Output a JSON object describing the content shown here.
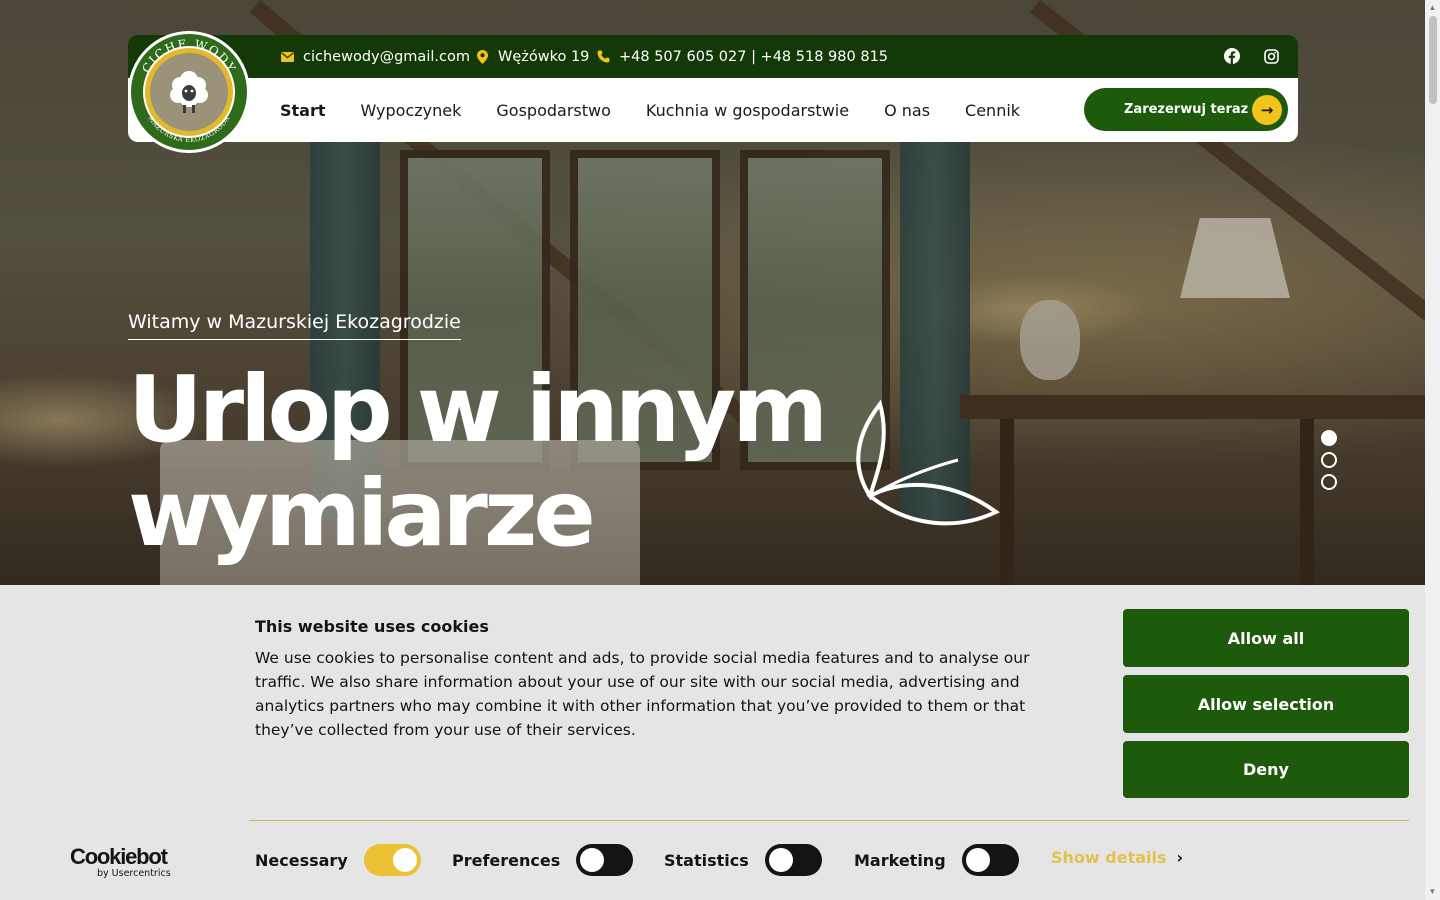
{
  "header": {
    "email": "cichewody@gmail.com",
    "address": "Wężówko 19",
    "phone": "+48 507 605 027 | +48 518 980 815",
    "logo_top_text": "CICHE WODY",
    "logo_bottom_text": "MAZURSKA EKOZAGRODA",
    "nav": [
      "Start",
      "Wypoczynek",
      "Gospodarstwo",
      "Kuchnia w gospodarstwie",
      "O nas",
      "Cennik"
    ],
    "book_button": "Zarezerwuj teraz",
    "book_arrow": "→"
  },
  "hero": {
    "kicker": "Witamy w Mazurskiej Ekozagrodzie",
    "title_line1": "Urlop w innym",
    "title_line2": "wymiarze",
    "slides_total": 3,
    "active_slide": 1
  },
  "cookie": {
    "title": "This website uses cookies",
    "body": "We use cookies to personalise content and ads, to provide social media features and to analyse our traffic. We also share information about your use of our site with our social media, advertising and analytics partners who may combine it with other information that you’ve provided to them or that they’ve collected from your use of their services.",
    "allow_all": "Allow all",
    "allow_selection": "Allow selection",
    "deny": "Deny",
    "brand_big": "Cookiebot",
    "brand_small": "by Usercentrics",
    "toggles": {
      "necessary": "Necessary",
      "preferences": "Preferences",
      "statistics": "Statistics",
      "marketing": "Marketing"
    },
    "show_details": "Show details",
    "chevron": "›"
  },
  "colors": {
    "dark_green": "#133a06",
    "button_green": "#1e5a0b",
    "accent_yellow": "#f0c419",
    "banner_bg": "#e5e5e5"
  },
  "icons": [
    "mail-icon",
    "map-pin-icon",
    "phone-icon",
    "facebook-icon",
    "instagram-icon",
    "sheep-icon",
    "leaf-icon",
    "arrow-right-icon",
    "chevron-right-icon"
  ]
}
